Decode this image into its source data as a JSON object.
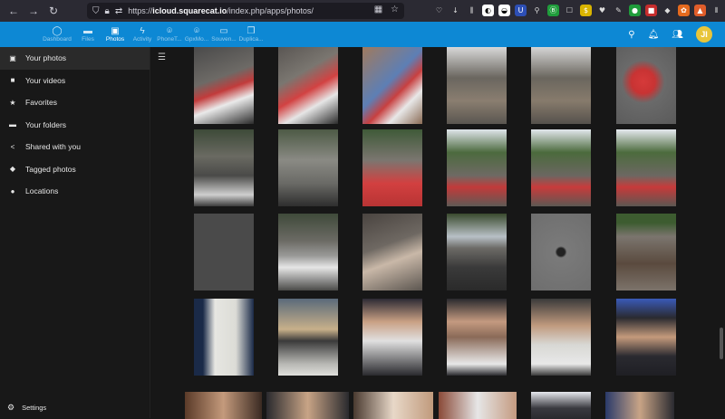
{
  "browser": {
    "url_prefix": "https://",
    "url_host": "icloud.squarecat.io",
    "url_path": "/index.php/apps/photos/"
  },
  "appbar": {
    "items": [
      {
        "label": "Dashboard",
        "icon": "dashboard-icon",
        "glyph": "◯"
      },
      {
        "label": "Files",
        "icon": "folder-icon",
        "glyph": "▬"
      },
      {
        "label": "Photos",
        "icon": "photos-icon",
        "glyph": "▣"
      },
      {
        "label": "Activity",
        "icon": "activity-icon",
        "glyph": "ϟ"
      },
      {
        "label": "PhoneT...",
        "icon": "phonetrack-icon",
        "glyph": "⌾"
      },
      {
        "label": "GpxMo...",
        "icon": "gpxmotion-icon",
        "glyph": "⌾"
      },
      {
        "label": "Souven...",
        "icon": "souvenirs-icon",
        "glyph": "▭"
      },
      {
        "label": "Duplica...",
        "icon": "duplicates-icon",
        "glyph": "❐"
      }
    ],
    "avatar_initials": "JI"
  },
  "sidebar": {
    "items": [
      {
        "label": "Your photos",
        "icon": "image-icon",
        "glyph": "▣"
      },
      {
        "label": "Your videos",
        "icon": "video-icon",
        "glyph": "■"
      },
      {
        "label": "Favorites",
        "icon": "star-icon",
        "glyph": "★"
      },
      {
        "label": "Your folders",
        "icon": "folder-icon",
        "glyph": "▬"
      },
      {
        "label": "Shared with you",
        "icon": "share-icon",
        "glyph": "<"
      },
      {
        "label": "Tagged photos",
        "icon": "tag-icon",
        "glyph": "◆"
      },
      {
        "label": "Locations",
        "icon": "location-icon",
        "glyph": "●"
      }
    ],
    "settings_label": "Settings"
  },
  "colors": {
    "accent": "#0d88d4",
    "background": "#171717",
    "sidebar_active": "#2a2a2a"
  }
}
